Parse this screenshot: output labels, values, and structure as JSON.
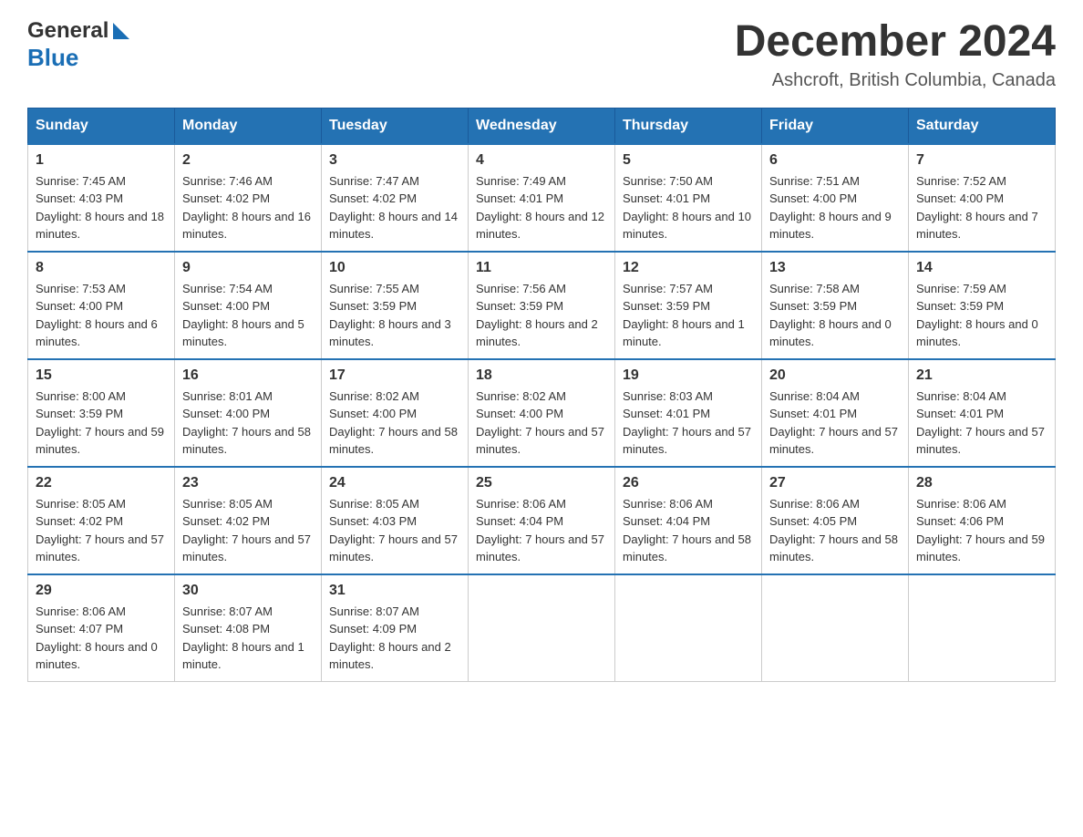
{
  "header": {
    "logo_general": "General",
    "logo_blue": "Blue",
    "month_title": "December 2024",
    "location": "Ashcroft, British Columbia, Canada"
  },
  "days_of_week": [
    "Sunday",
    "Monday",
    "Tuesday",
    "Wednesday",
    "Thursday",
    "Friday",
    "Saturday"
  ],
  "weeks": [
    [
      {
        "day": 1,
        "sunrise": "7:45 AM",
        "sunset": "4:03 PM",
        "daylight": "8 hours and 18 minutes."
      },
      {
        "day": 2,
        "sunrise": "7:46 AM",
        "sunset": "4:02 PM",
        "daylight": "8 hours and 16 minutes."
      },
      {
        "day": 3,
        "sunrise": "7:47 AM",
        "sunset": "4:02 PM",
        "daylight": "8 hours and 14 minutes."
      },
      {
        "day": 4,
        "sunrise": "7:49 AM",
        "sunset": "4:01 PM",
        "daylight": "8 hours and 12 minutes."
      },
      {
        "day": 5,
        "sunrise": "7:50 AM",
        "sunset": "4:01 PM",
        "daylight": "8 hours and 10 minutes."
      },
      {
        "day": 6,
        "sunrise": "7:51 AM",
        "sunset": "4:00 PM",
        "daylight": "8 hours and 9 minutes."
      },
      {
        "day": 7,
        "sunrise": "7:52 AM",
        "sunset": "4:00 PM",
        "daylight": "8 hours and 7 minutes."
      }
    ],
    [
      {
        "day": 8,
        "sunrise": "7:53 AM",
        "sunset": "4:00 PM",
        "daylight": "8 hours and 6 minutes."
      },
      {
        "day": 9,
        "sunrise": "7:54 AM",
        "sunset": "4:00 PM",
        "daylight": "8 hours and 5 minutes."
      },
      {
        "day": 10,
        "sunrise": "7:55 AM",
        "sunset": "3:59 PM",
        "daylight": "8 hours and 3 minutes."
      },
      {
        "day": 11,
        "sunrise": "7:56 AM",
        "sunset": "3:59 PM",
        "daylight": "8 hours and 2 minutes."
      },
      {
        "day": 12,
        "sunrise": "7:57 AM",
        "sunset": "3:59 PM",
        "daylight": "8 hours and 1 minute."
      },
      {
        "day": 13,
        "sunrise": "7:58 AM",
        "sunset": "3:59 PM",
        "daylight": "8 hours and 0 minutes."
      },
      {
        "day": 14,
        "sunrise": "7:59 AM",
        "sunset": "3:59 PM",
        "daylight": "8 hours and 0 minutes."
      }
    ],
    [
      {
        "day": 15,
        "sunrise": "8:00 AM",
        "sunset": "3:59 PM",
        "daylight": "7 hours and 59 minutes."
      },
      {
        "day": 16,
        "sunrise": "8:01 AM",
        "sunset": "4:00 PM",
        "daylight": "7 hours and 58 minutes."
      },
      {
        "day": 17,
        "sunrise": "8:02 AM",
        "sunset": "4:00 PM",
        "daylight": "7 hours and 58 minutes."
      },
      {
        "day": 18,
        "sunrise": "8:02 AM",
        "sunset": "4:00 PM",
        "daylight": "7 hours and 57 minutes."
      },
      {
        "day": 19,
        "sunrise": "8:03 AM",
        "sunset": "4:01 PM",
        "daylight": "7 hours and 57 minutes."
      },
      {
        "day": 20,
        "sunrise": "8:04 AM",
        "sunset": "4:01 PM",
        "daylight": "7 hours and 57 minutes."
      },
      {
        "day": 21,
        "sunrise": "8:04 AM",
        "sunset": "4:01 PM",
        "daylight": "7 hours and 57 minutes."
      }
    ],
    [
      {
        "day": 22,
        "sunrise": "8:05 AM",
        "sunset": "4:02 PM",
        "daylight": "7 hours and 57 minutes."
      },
      {
        "day": 23,
        "sunrise": "8:05 AM",
        "sunset": "4:02 PM",
        "daylight": "7 hours and 57 minutes."
      },
      {
        "day": 24,
        "sunrise": "8:05 AM",
        "sunset": "4:03 PM",
        "daylight": "7 hours and 57 minutes."
      },
      {
        "day": 25,
        "sunrise": "8:06 AM",
        "sunset": "4:04 PM",
        "daylight": "7 hours and 57 minutes."
      },
      {
        "day": 26,
        "sunrise": "8:06 AM",
        "sunset": "4:04 PM",
        "daylight": "7 hours and 58 minutes."
      },
      {
        "day": 27,
        "sunrise": "8:06 AM",
        "sunset": "4:05 PM",
        "daylight": "7 hours and 58 minutes."
      },
      {
        "day": 28,
        "sunrise": "8:06 AM",
        "sunset": "4:06 PM",
        "daylight": "7 hours and 59 minutes."
      }
    ],
    [
      {
        "day": 29,
        "sunrise": "8:06 AM",
        "sunset": "4:07 PM",
        "daylight": "8 hours and 0 minutes."
      },
      {
        "day": 30,
        "sunrise": "8:07 AM",
        "sunset": "4:08 PM",
        "daylight": "8 hours and 1 minute."
      },
      {
        "day": 31,
        "sunrise": "8:07 AM",
        "sunset": "4:09 PM",
        "daylight": "8 hours and 2 minutes."
      },
      null,
      null,
      null,
      null
    ]
  ]
}
